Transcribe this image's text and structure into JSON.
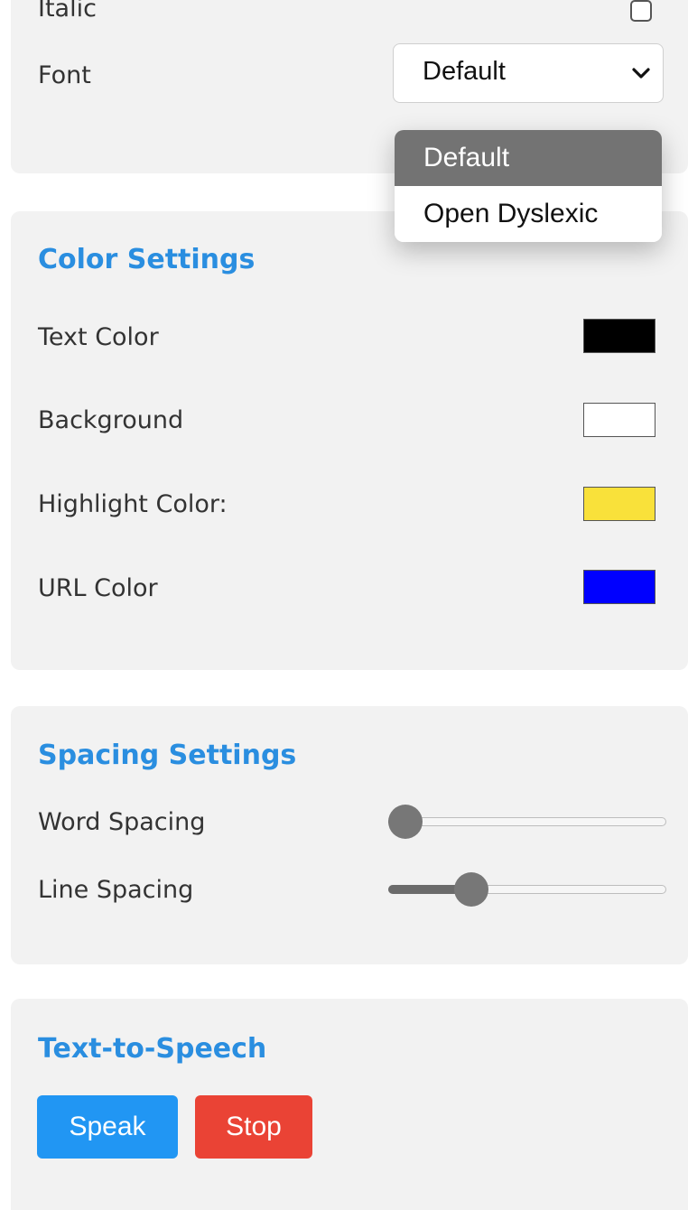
{
  "font_settings": {
    "italic_label": "Italic",
    "italic_checked": false,
    "font_label": "Font",
    "font_selected": "Default",
    "font_options": [
      "Default",
      "Open Dyslexic"
    ]
  },
  "color_settings": {
    "title": "Color Settings",
    "items": [
      {
        "label": "Text Color",
        "color": "#000000"
      },
      {
        "label": "Background",
        "color": "#ffffff"
      },
      {
        "label": "Highlight Color:",
        "color": "#f9e13a"
      },
      {
        "label": "URL Color",
        "color": "#0000ff"
      }
    ]
  },
  "spacing_settings": {
    "title": "Spacing Settings",
    "sliders": [
      {
        "label": "Word Spacing",
        "value_fraction": 0.0
      },
      {
        "label": "Line Spacing",
        "value_fraction": 0.27
      }
    ]
  },
  "tts": {
    "title": "Text-to-Speech",
    "speak_label": "Speak",
    "stop_label": "Stop"
  },
  "colors": {
    "accent": "#2a8ee0",
    "speak_button": "#2196f3",
    "stop_button": "#ea4335"
  }
}
